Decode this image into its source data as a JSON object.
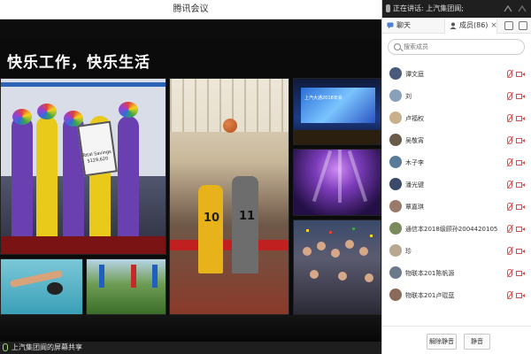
{
  "window": {
    "title": "腾讯会议"
  },
  "slide": {
    "title": "快乐工作，快乐生活"
  },
  "photo1": {
    "sign_text": "Total Savings $129,620"
  },
  "photo2": {
    "jersey_a": "10",
    "jersey_b": "11"
  },
  "photo3": {
    "screen_text": "上汽大通2018年会"
  },
  "share": {
    "label": "上汽集团阆的屏幕共享"
  },
  "panel": {
    "speaking": "正在讲话: 上汽集团阆;",
    "tabs": {
      "chat": "聊天",
      "members": "成员(86)"
    },
    "search_placeholder": "搜索成员",
    "members": [
      {
        "name": "谭文庭",
        "avatar_color": "#4a5a7a"
      },
      {
        "name": "刘",
        "avatar_color": "#8aa0b8"
      },
      {
        "name": "卢福权",
        "avatar_color": "#c8b08a"
      },
      {
        "name": "吴敬宵",
        "avatar_color": "#6a5a4a"
      },
      {
        "name": "木子李",
        "avatar_color": "#5a7a9a"
      },
      {
        "name": "潘光键",
        "avatar_color": "#3a4a6a"
      },
      {
        "name": "覃嘉琪",
        "avatar_color": "#9a7a6a"
      },
      {
        "name": "通信本2018级顾孙2004420105",
        "avatar_color": "#7a8a5a"
      },
      {
        "name": "珍",
        "avatar_color": "#b8a890"
      },
      {
        "name": "物联本201陈帆源",
        "avatar_color": "#6a7a8a"
      },
      {
        "name": "物联本201卢琨蓝",
        "avatar_color": "#8a6a5a"
      }
    ],
    "buttons": {
      "unmute_all": "解除静音",
      "mute_all": "静音"
    }
  },
  "colors": {
    "mic_off": "#d94a4a",
    "accent_blue": "#2d64b8"
  }
}
